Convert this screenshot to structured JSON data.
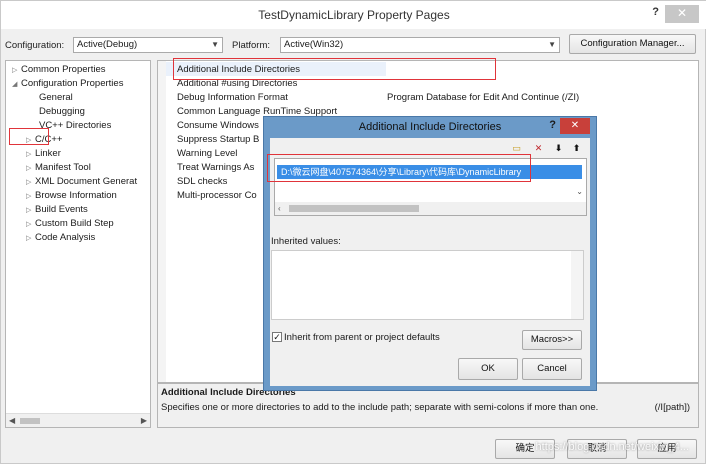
{
  "window": {
    "title": "TestDynamicLibrary Property Pages",
    "help": "?",
    "close": "✕"
  },
  "config": {
    "configuration_label": "Configuration:",
    "configuration_value": "Active(Debug)",
    "platform_label": "Platform:",
    "platform_value": "Active(Win32)",
    "manager_button": "Configuration Manager..."
  },
  "tree": {
    "items": [
      {
        "label": "Common Properties"
      },
      {
        "label": "Configuration Properties"
      },
      {
        "label": "General"
      },
      {
        "label": "Debugging"
      },
      {
        "label": "VC++ Directories"
      },
      {
        "label": "C/C++"
      },
      {
        "label": "Linker"
      },
      {
        "label": "Manifest Tool"
      },
      {
        "label": "XML Document Generat"
      },
      {
        "label": "Browse Information"
      },
      {
        "label": "Build Events"
      },
      {
        "label": "Custom Build Step"
      },
      {
        "label": "Code Analysis"
      }
    ]
  },
  "properties": {
    "names": [
      "Additional Include Directories",
      "Additional #using Directories",
      "Debug Information Format",
      "Common Language RunTime Support",
      "Consume Windows",
      "Suppress Startup B",
      "Warning Level",
      "Treat Warnings As",
      "SDL checks",
      "Multi-processor Co"
    ],
    "debug_value": "Program Database for Edit And Continue (/ZI)"
  },
  "description": {
    "title": "Additional Include Directories",
    "text": "Specifies one or more directories to add to the include path; separate with semi-colons if more than one.",
    "flag": "(/I[path])"
  },
  "dialog": {
    "title": "Additional Include Directories",
    "help": "?",
    "close": "✕",
    "path": "D:\\微云网盘\\407574364\\分享\\Library\\代码库\\DynamicLibrary",
    "inherited_label": "Inherited values:",
    "inherit_checkbox": "Inherit from parent or project defaults",
    "macros_button": "Macros>>",
    "ok_button": "OK",
    "cancel_button": "Cancel"
  },
  "bottom": {
    "ok_button": "确定",
    "cancel_button": "取消",
    "apply_button": "应用",
    "watermark": "https://blog.csdn.net/weixin_4..."
  }
}
